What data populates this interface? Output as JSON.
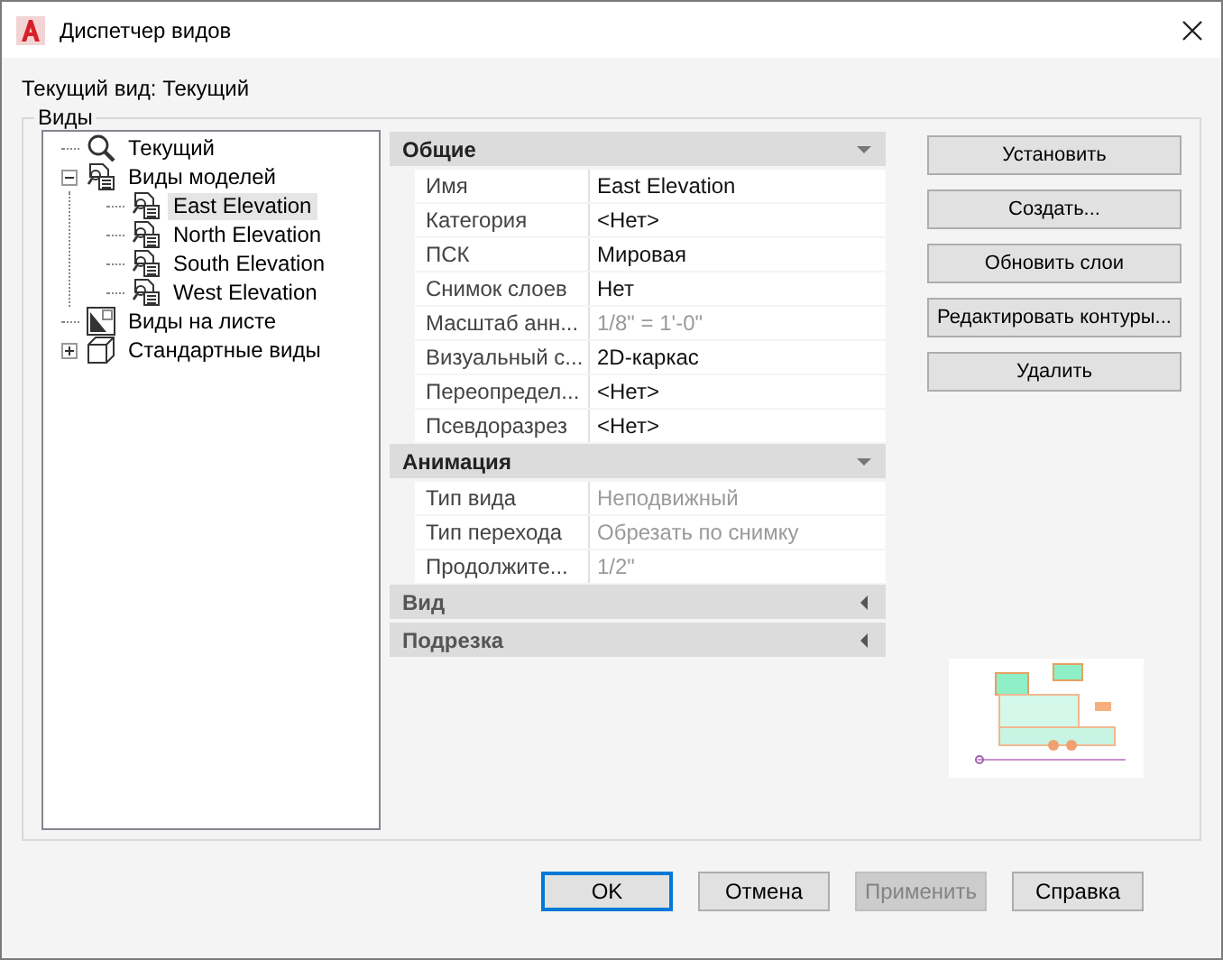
{
  "window": {
    "title": "Диспетчер видов"
  },
  "current_view": "Текущий вид: Текущий",
  "group_label": "Виды",
  "tree": [
    {
      "label": "Текущий",
      "kind": "current",
      "selected": false
    },
    {
      "label": "Виды моделей",
      "kind": "model",
      "expanded": true,
      "selected": false,
      "children": [
        {
          "label": "East Elevation",
          "kind": "view",
          "selected": true
        },
        {
          "label": "North Elevation",
          "kind": "view",
          "selected": false
        },
        {
          "label": "South Elevation",
          "kind": "view",
          "selected": false
        },
        {
          "label": "West Elevation",
          "kind": "view",
          "selected": false
        }
      ]
    },
    {
      "label": "Виды на листе",
      "kind": "sheet",
      "selected": false
    },
    {
      "label": "Стандартные виды",
      "kind": "cube",
      "expanded": false,
      "selected": false
    }
  ],
  "sections": [
    {
      "title": "Общие",
      "expanded": true,
      "rows": [
        {
          "name": "Имя",
          "value": "East Elevation",
          "disabled": false
        },
        {
          "name": "Категория",
          "value": "<Нет>",
          "disabled": false
        },
        {
          "name": "ПСК",
          "value": "Мировая",
          "disabled": false
        },
        {
          "name": "Снимок слоев",
          "value": "Нет",
          "disabled": false
        },
        {
          "name": "Масштаб анн...",
          "value": "1/8\" = 1'-0\"",
          "disabled": true
        },
        {
          "name": "Визуальный с...",
          "value": "2D-каркас",
          "disabled": false
        },
        {
          "name": "Переопредел...",
          "value": "<Нет>",
          "disabled": false
        },
        {
          "name": "Псевдоразрез",
          "value": "<Нет>",
          "disabled": false
        }
      ]
    },
    {
      "title": "Анимация",
      "expanded": true,
      "rows": [
        {
          "name": "Тип вида",
          "value": "Неподвижный",
          "disabled": true
        },
        {
          "name": "Тип перехода",
          "value": "Обрезать по снимку",
          "disabled": true
        },
        {
          "name": "Продолжите...",
          "value": "1/2\"",
          "disabled": true
        }
      ]
    },
    {
      "title": "Вид",
      "expanded": false
    },
    {
      "title": "Подрезка",
      "expanded": false
    }
  ],
  "side_buttons": [
    "Установить",
    "Создать...",
    "Обновить слои",
    "Редактировать контуры...",
    "Удалить"
  ],
  "footer_buttons": [
    {
      "label": "OK",
      "default": true,
      "disabled": false
    },
    {
      "label": "Отмена",
      "default": false,
      "disabled": false
    },
    {
      "label": "Применить",
      "default": false,
      "disabled": true
    },
    {
      "label": "Справка",
      "default": false,
      "disabled": false
    }
  ]
}
